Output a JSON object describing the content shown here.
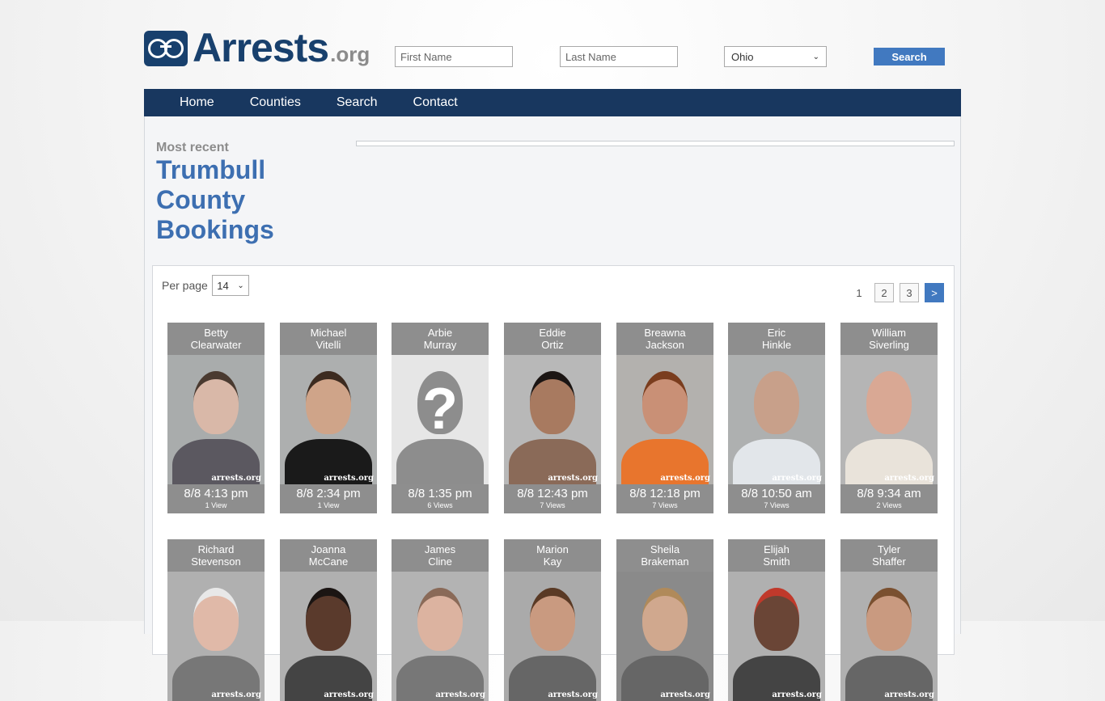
{
  "logo": {
    "name": "Arrests",
    "tld": ".org"
  },
  "search": {
    "first_placeholder": "First Name",
    "last_placeholder": "Last Name",
    "state": "Ohio",
    "button": "Search"
  },
  "nav": [
    "Home",
    "Counties",
    "Search",
    "Contact"
  ],
  "heading": {
    "most_recent": "Most recent",
    "title": "Trumbull County Bookings"
  },
  "listing": {
    "per_page_label": "Per page",
    "per_page": "14",
    "pages": [
      "1",
      "2",
      "3"
    ],
    "next": ">"
  },
  "watermark": "arrests.org",
  "people": [
    {
      "first": "Betty",
      "last": "Clearwater",
      "time": "8/8 4:13 pm",
      "views": "1 View",
      "skin": "#d9b8a8",
      "bg": "#a9acac",
      "shirt": "#5b5860",
      "hair": "#4a3a30"
    },
    {
      "first": "Michael",
      "last": "Vitelli",
      "time": "8/8 2:34 pm",
      "views": "1 View",
      "skin": "#cfa489",
      "bg": "#adafaf",
      "shirt": "#1a1a1a",
      "hair": "#3d2b20"
    },
    {
      "first": "Arbie",
      "last": "Murray",
      "time": "8/8 1:35 pm",
      "views": "6 Views",
      "skin": "#8d8d8d",
      "bg": "#e6e6e6",
      "shirt": "#8d8d8d",
      "hair": "#8d8d8d",
      "placeholder": true
    },
    {
      "first": "Eddie",
      "last": "Ortiz",
      "time": "8/8 12:43 pm",
      "views": "7 Views",
      "skin": "#a87a60",
      "bg": "#b8b8b8",
      "shirt": "#8a6a58",
      "hair": "#1b1513"
    },
    {
      "first": "Breawna",
      "last": "Jackson",
      "time": "8/8 12:18 pm",
      "views": "7 Views",
      "skin": "#c99076",
      "bg": "#b3b1ae",
      "shirt": "#e8752d",
      "hair": "#7a3d1e"
    },
    {
      "first": "Eric",
      "last": "Hinkle",
      "time": "8/8 10:50 am",
      "views": "7 Views",
      "skin": "#c8a08a",
      "bg": "#aeb0b0",
      "shirt": "#e2e6ea",
      "hair": "#c8a08a"
    },
    {
      "first": "William",
      "last": "Siverling",
      "time": "8/8 9:34 am",
      "views": "2 Views",
      "skin": "#d9a894",
      "bg": "#b5b5b5",
      "shirt": "#e9e3da",
      "hair": "#d9a894"
    },
    {
      "first": "Richard",
      "last": "Stevenson",
      "time": "",
      "views": "",
      "skin": "#e0b9a8",
      "bg": "#b0b0b0",
      "shirt": "#777",
      "hair": "#e8e8e8"
    },
    {
      "first": "Joanna",
      "last": "McCane",
      "time": "",
      "views": "",
      "skin": "#5a3a2c",
      "bg": "#b0b0b0",
      "shirt": "#444",
      "hair": "#1b1513"
    },
    {
      "first": "James",
      "last": "Cline",
      "time": "",
      "views": "",
      "skin": "#dcb3a0",
      "bg": "#b3b3b3",
      "shirt": "#777",
      "hair": "#8a6a58"
    },
    {
      "first": "Marion",
      "last": "Kay",
      "time": "",
      "views": "",
      "skin": "#c99a80",
      "bg": "#aaa",
      "shirt": "#666",
      "hair": "#5a3a25"
    },
    {
      "first": "Sheila",
      "last": "Brakeman",
      "time": "",
      "views": "",
      "skin": "#d0a88e",
      "bg": "#8a8a8a",
      "shirt": "#666",
      "hair": "#b08a5a"
    },
    {
      "first": "Elijah",
      "last": "Smith",
      "time": "",
      "views": "",
      "skin": "#6a4536",
      "bg": "#b0b0b0",
      "shirt": "#444",
      "hair": "#c0392b"
    },
    {
      "first": "Tyler",
      "last": "Shaffer",
      "time": "",
      "views": "",
      "skin": "#c99a80",
      "bg": "#b0b0b0",
      "shirt": "#666",
      "hair": "#7a5030"
    }
  ]
}
